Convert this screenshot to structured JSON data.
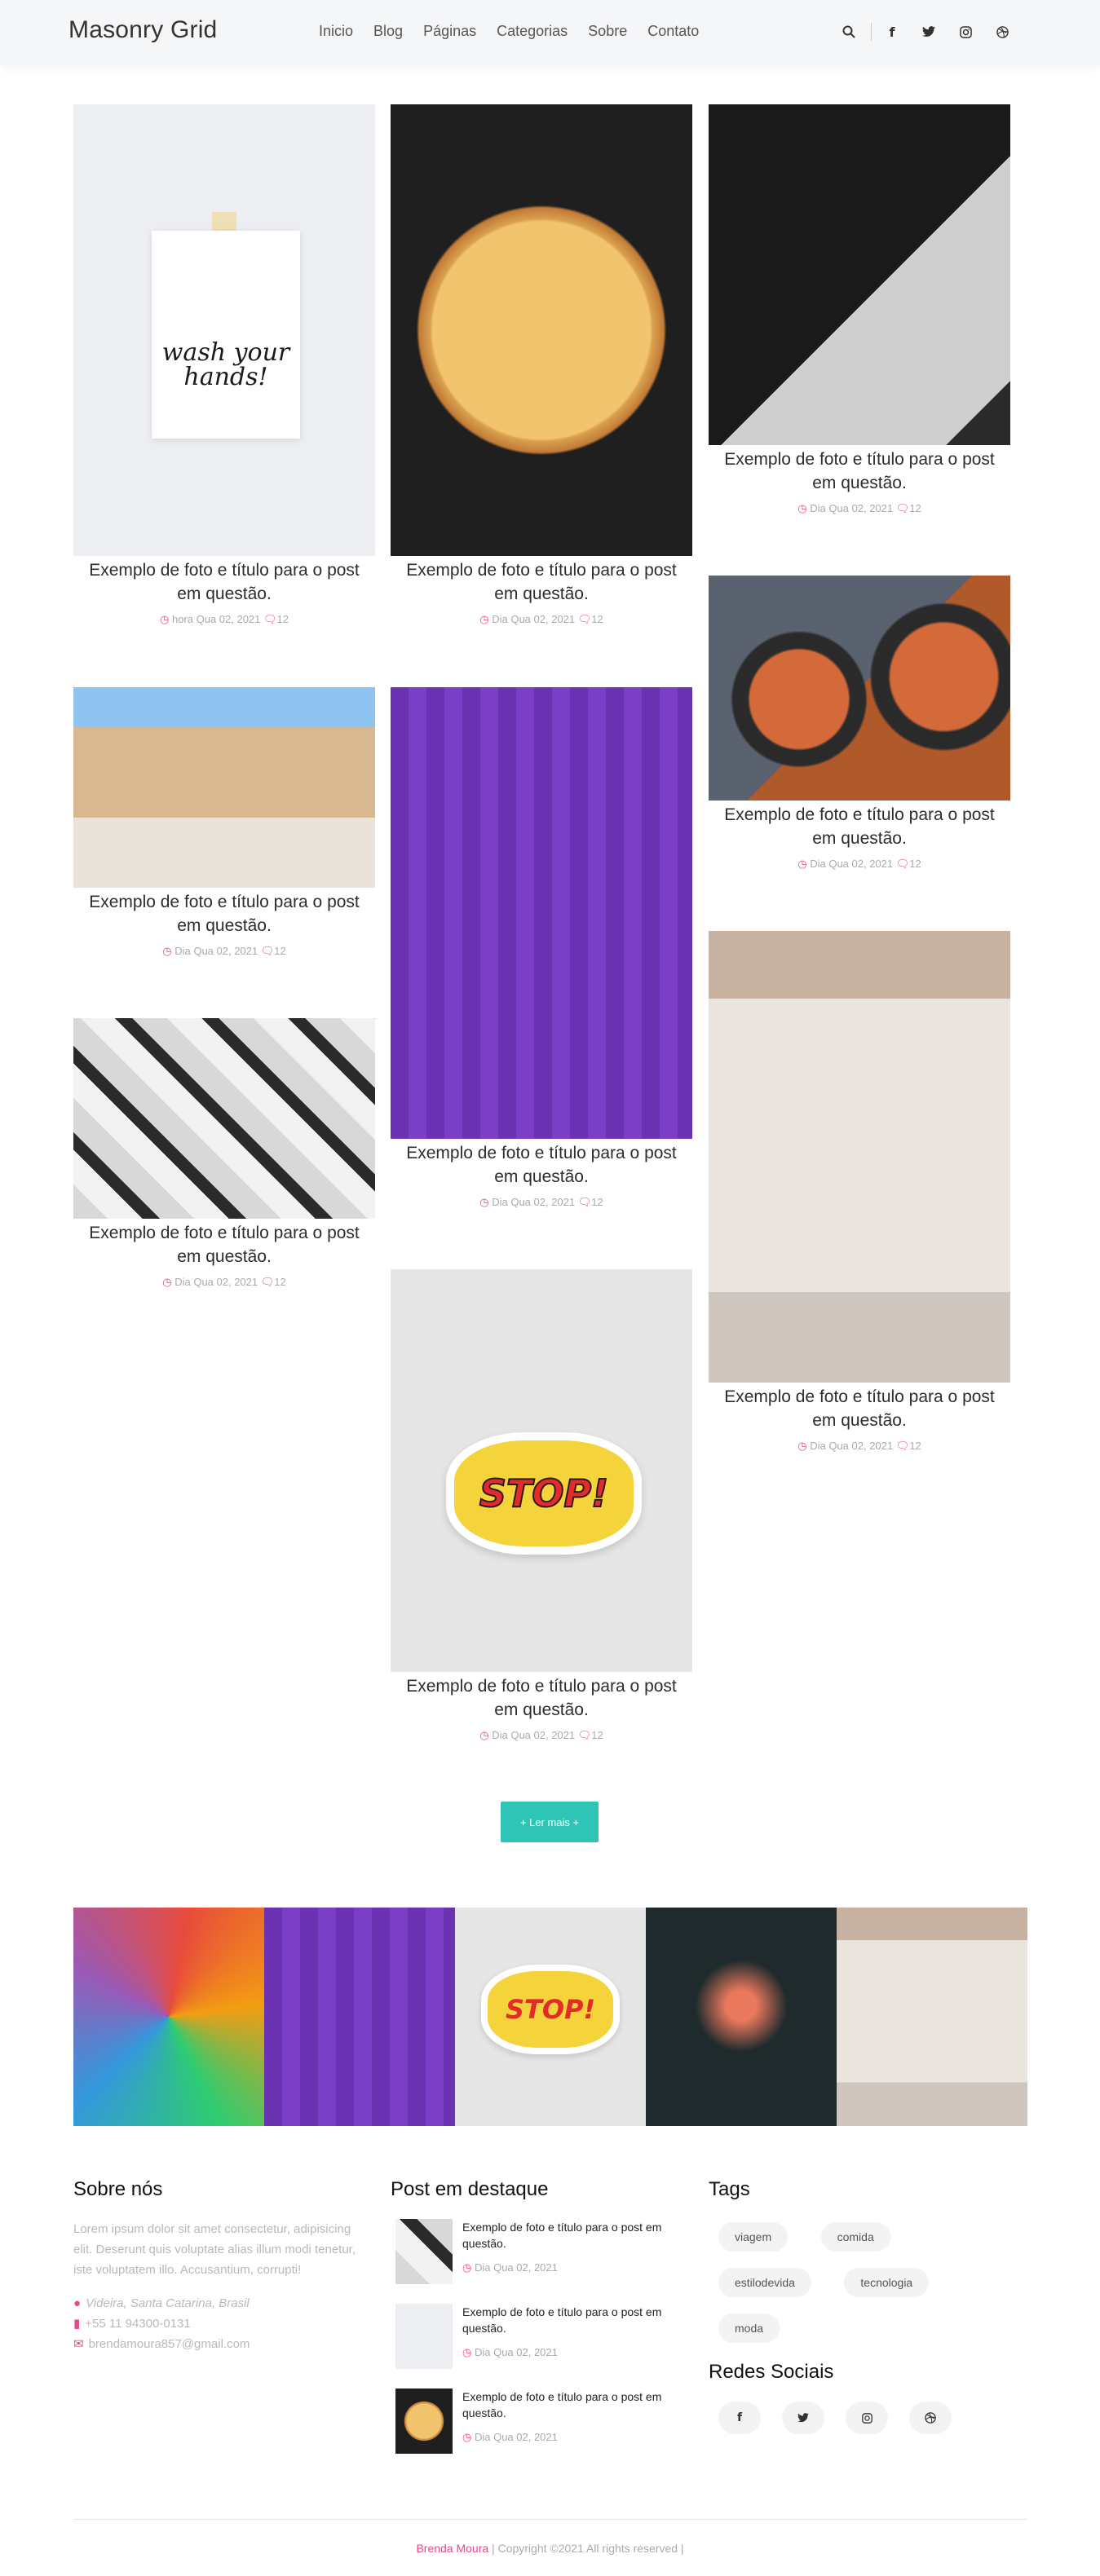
{
  "header": {
    "brand": "Masonry Grid",
    "nav": [
      "Inicio",
      "Blog",
      "Páginas",
      "Categorias",
      "Sobre",
      "Contato"
    ],
    "icons": [
      "search-icon",
      "facebook-icon",
      "twitter-icon",
      "instagram-icon",
      "dribbble-icon"
    ]
  },
  "posts": [
    {
      "title": "Exemplo de foto e título para o post em questão.",
      "date": "hora Qua 02, 2021",
      "comments": "12",
      "image": "wash-your-hands-card"
    },
    {
      "title": "Exemplo de foto e título para o post em questão.",
      "date": "Dia Qua 02, 2021",
      "comments": "12",
      "image": "pizza"
    },
    {
      "title": "Exemplo de foto e título para o post em questão.",
      "date": "Dia Qua 02, 2021",
      "comments": "12",
      "image": "laptop-desk"
    },
    {
      "title": "Exemplo de foto e título para o post em questão.",
      "date": "Dia Qua 02, 2021",
      "comments": "12",
      "image": "woman-arches"
    },
    {
      "title": "Exemplo de foto e título para o post em questão.",
      "date": "Dia Qua 02, 2021",
      "comments": "12",
      "image": "woman-purple-wall"
    },
    {
      "title": "Exemplo de foto e título para o post em questão.",
      "date": "Dia Qua 02, 2021",
      "comments": "12",
      "image": "food-bowls"
    },
    {
      "title": "Exemplo de foto e título para o post em questão.",
      "date": "Dia Qua 02, 2021",
      "comments": "12",
      "image": "stickers"
    },
    {
      "title": "Exemplo de foto e título para o post em questão.",
      "date": "Dia Qua 02, 2021",
      "comments": "12",
      "image": "woman-white-dress"
    },
    {
      "title": "Exemplo de foto e título para o post em questão.",
      "date": "Dia Qua 02, 2021",
      "comments": "12",
      "image": "stop-sticker"
    }
  ],
  "image_text": {
    "wash_card": "wash your hands!",
    "stop_sticker": "STOP!"
  },
  "load_more": "+ Ler mais +",
  "gallery": [
    "colorful-face-mural",
    "woman-purple-wall",
    "stop-sticker",
    "lamp-in-hand",
    "woman-white-dress"
  ],
  "footer": {
    "about": {
      "title": "Sobre nós",
      "text": "Lorem ipsum dolor sit amet consectetur, adipisicing elit. Deserunt quis voluptate alias illum modi tenetur, iste voluptatem illo. Accusantium, corrupti!",
      "address": "Videira, Santa Catarina, Brasil",
      "phone": "+55 11 94300-0131",
      "email": "brendamoura857@gmail.com"
    },
    "featured": {
      "title": "Post em destaque",
      "items": [
        {
          "title": "Exemplo de foto e título para o post em questão.",
          "date": "Dia Qua 02, 2021"
        },
        {
          "title": "Exemplo de foto e título para o post em questão.",
          "date": "Dia Qua 02, 2021"
        },
        {
          "title": "Exemplo de foto e título para o post em questão.",
          "date": "Dia Qua 02, 2021"
        }
      ]
    },
    "tags": {
      "title": "Tags",
      "items": [
        "viagem",
        "comida",
        "estilodevida",
        "tecnologia",
        "moda"
      ]
    },
    "social": {
      "title": "Redes Sociais",
      "icons": [
        "facebook-icon",
        "twitter-icon",
        "instagram-icon",
        "dribbble-icon"
      ]
    },
    "copyright": {
      "author": "Brenda Moura",
      "text": " | Copyright ©2021 All rights reserved |"
    }
  },
  "colors": {
    "accent": "#e9468d",
    "button": "#2ec4b6",
    "header_bg": "#f5f6f8"
  }
}
